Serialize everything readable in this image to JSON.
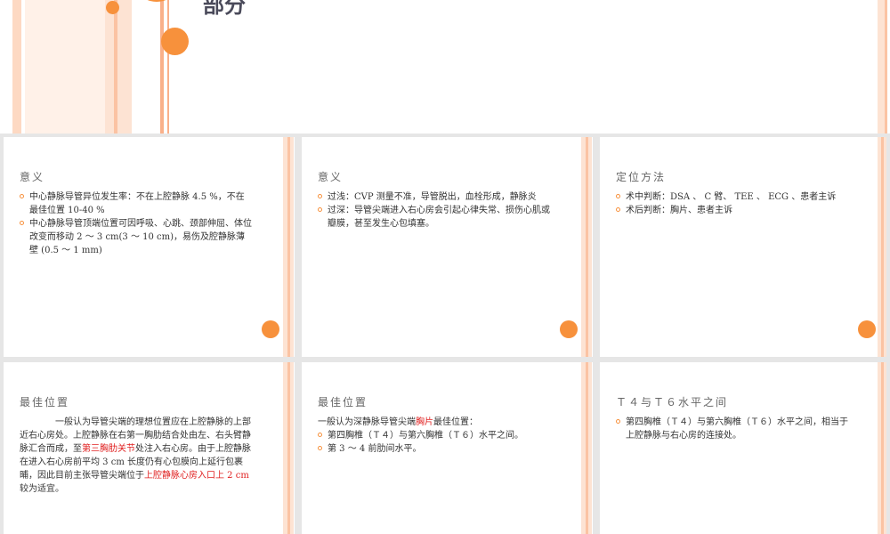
{
  "top_slide": {
    "title_fragment": "部分"
  },
  "slides": [
    {
      "title": "意义",
      "bullets": [
        "中心静脉导管异位发生率：不在上腔静脉 4.5 %，不在最佳位置 10-40 %",
        "中心静脉导管顶端位置可因呼吸、心跳、颈部伸屈、体位改变而移动 2 ～ 3 cm(3 ～ 10 cm)，易伤及腔静脉薄壁 (0.5 ～ 1 mm)"
      ]
    },
    {
      "title": "意义",
      "bullets": [
        "过浅：CVP 测量不准，导管脱出，血栓形成，静脉炎",
        "过深：导管尖端进入右心房会引起心律失常、损伤心肌或瓣膜，甚至发生心包填塞。"
      ]
    },
    {
      "title": "定位方法",
      "bullets": [
        "术中判断：DSA 、 C 臂、 TEE 、 ECG 、患者主诉",
        "术后判断：胸片、患者主诉"
      ]
    },
    {
      "title": "最佳位置",
      "para_parts": [
        "一般认为导管尖端的理想位置应在上腔静脉的上部近右心房处。上腔静脉在右第一胸肋结合处由左、右头臂静脉汇合而成，至",
        "第三胸肋关节",
        "处注入右心房。由于上腔静脉在进入右心房前平均 3 cm 长度仍有心包膜向上延行包裹晡，因此目前主张导管尖端位于",
        "上腔静脉心房入口上 2 cm",
        " 较为适宜。"
      ]
    },
    {
      "title": "最佳位置",
      "intro_parts": [
        "一般认为深静脉导管尖端",
        "胸片",
        "最佳位置："
      ],
      "bullets": [
        "第四胸椎（Ｔ４）与第六胸椎（Ｔ６）水平之间。",
        "第 3 ～ 4 前肋间水平。"
      ]
    },
    {
      "title": "Ｔ４与Ｔ６水平之间",
      "bullets": [
        "第四胸椎（Ｔ４）与第六胸椎（Ｔ６）水平之间，相当于上腔静脉与右心房的连接处。"
      ]
    }
  ]
}
